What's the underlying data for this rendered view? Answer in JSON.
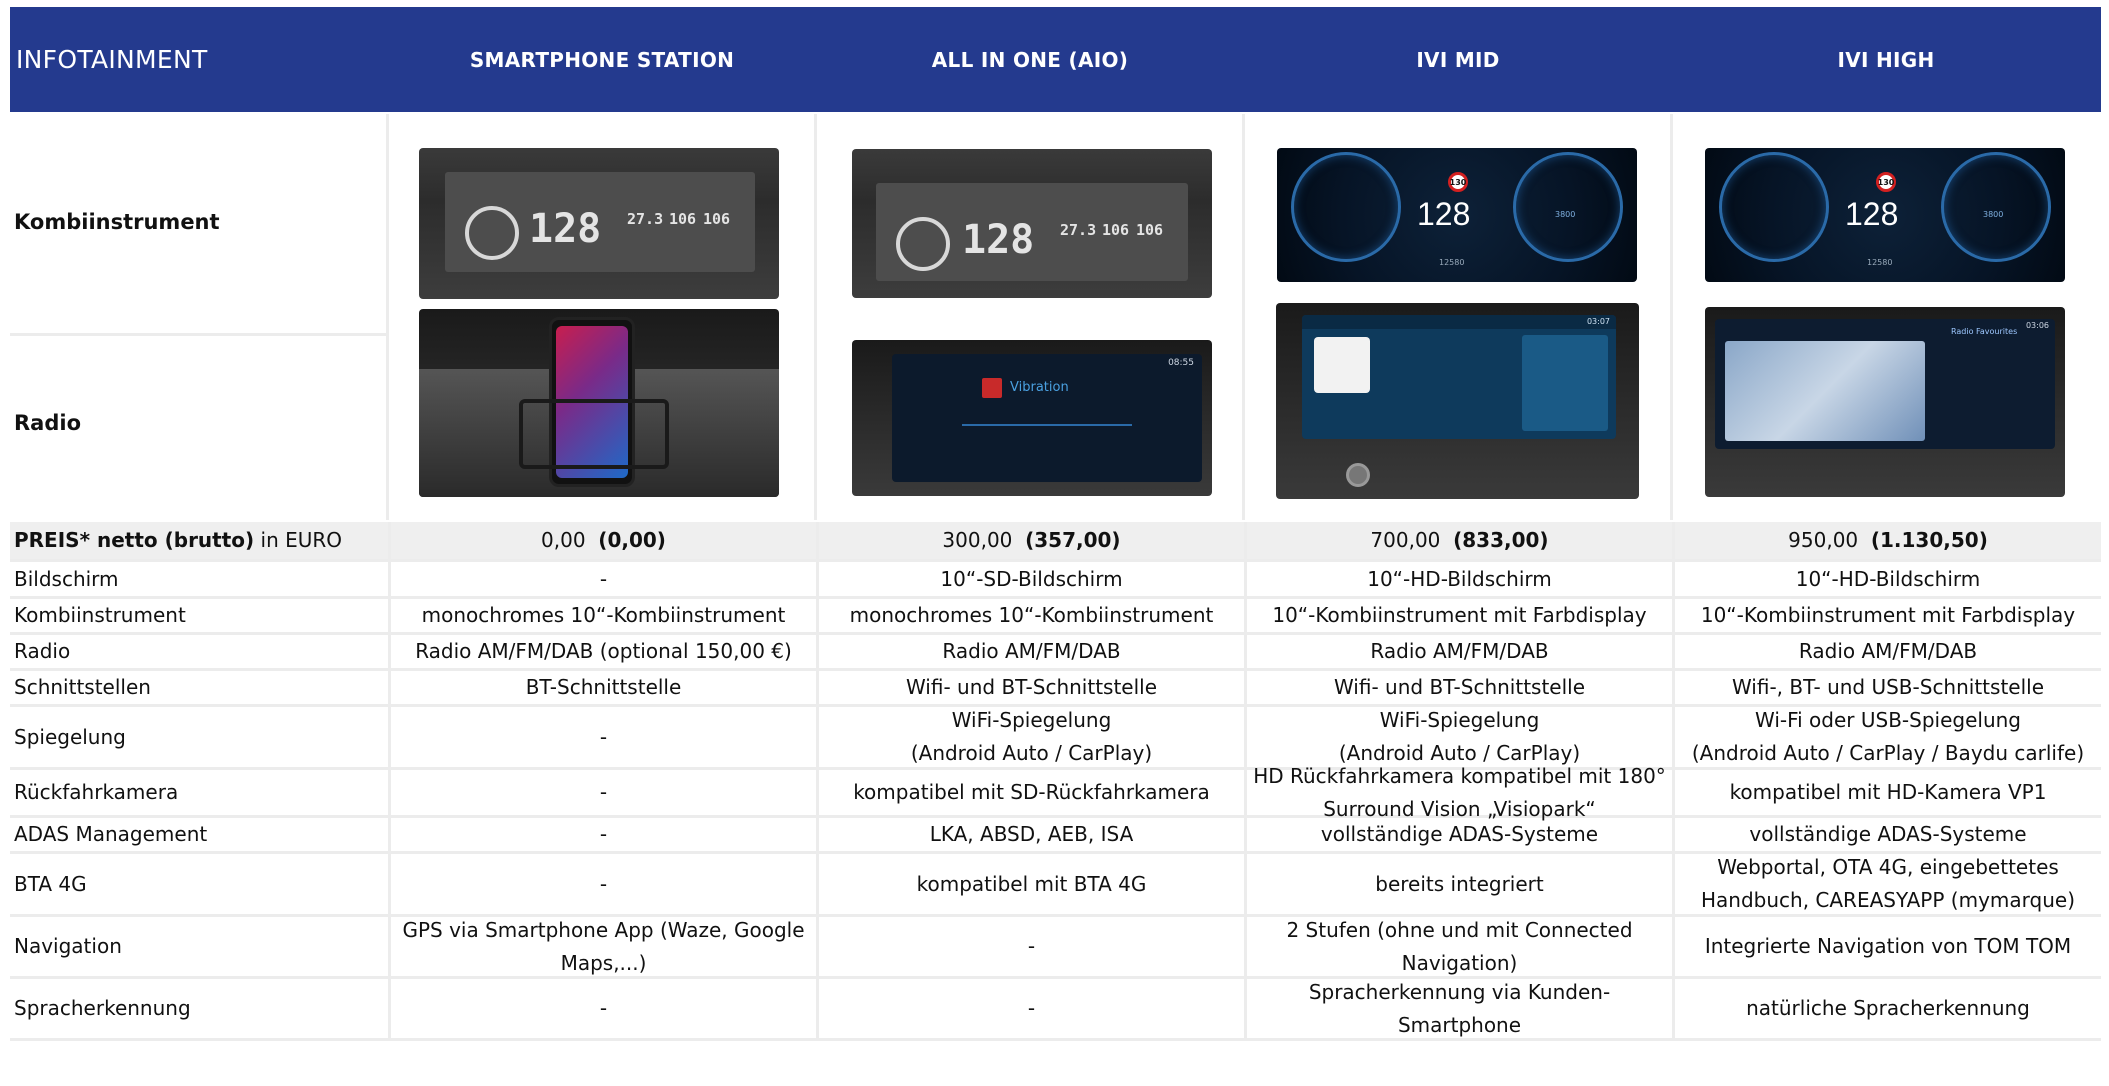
{
  "header": {
    "title": "INFOTAINMENT",
    "columns": [
      "SMARTPHONE STATION",
      "ALL IN ONE (AIO)",
      "IVI MID",
      "IVI HIGH"
    ]
  },
  "image_rows": {
    "kombi_label": "Kombiinstrument",
    "radio_label": "Radio"
  },
  "shots": {
    "mono_speed": "128",
    "mono_small": [
      "27.3",
      "106",
      "106"
    ],
    "color_speed": "128",
    "color_sign": "130",
    "color_rpm": "3800",
    "color_odo": "12580",
    "aio_radio_title": "Vibration",
    "aio_radio_time": "08:55",
    "mid_radio_time": "03:07",
    "high_radio_title": "Radio Favourites",
    "high_radio_time": "03:06"
  },
  "price_row": {
    "label_bold": "PREIS* netto (brutto)",
    "label_rest": " in EURO",
    "values": [
      {
        "net": "0,00",
        "gross": "(0,00)"
      },
      {
        "net": "300,00",
        "gross": "(357,00)"
      },
      {
        "net": "700,00",
        "gross": "(833,00)"
      },
      {
        "net": "950,00",
        "gross": "(1.130,50)"
      }
    ]
  },
  "rows": [
    {
      "label": "Bildschirm",
      "cells": [
        "-",
        "10“-SD-Bildschirm",
        "10“-HD-Bildschirm",
        "10“-HD-Bildschirm"
      ]
    },
    {
      "label": "Kombiinstrument",
      "cells": [
        "monochromes 10“-Kombiinstrument",
        "monochromes 10“-Kombiinstrument",
        "10“-Kombiinstrument mit Farbdisplay",
        "10“-Kombiinstrument mit Farbdisplay"
      ]
    },
    {
      "label": "Radio",
      "cells": [
        "Radio AM/FM/DAB (optional 150,00 €)",
        "Radio AM/FM/DAB",
        "Radio AM/FM/DAB",
        "Radio AM/FM/DAB"
      ]
    },
    {
      "label": "Schnittstellen",
      "cells": [
        "BT-Schnittstelle",
        "Wifi- und BT-Schnittstelle",
        "Wifi- und BT-Schnittstelle",
        "Wifi-, BT- und USB-Schnittstelle"
      ]
    },
    {
      "label": "Spiegelung",
      "cells": [
        "-",
        "WiFi-Spiegelung\n(Android Auto / CarPlay)",
        "WiFi-Spiegelung\n(Android Auto / CarPlay)",
        "Wi-Fi oder USB-Spiegelung\n(Android Auto / CarPlay / Baydu carlife)"
      ]
    },
    {
      "label": "Rückfahrkamera",
      "cells": [
        "-",
        "kompatibel mit SD-Rückfahrkamera",
        "HD Rückfahrkamera kompatibel mit 180°\nSurround Vision „Visiopark“",
        "kompatibel mit HD-Kamera VP1"
      ]
    },
    {
      "label": "ADAS Management",
      "cells": [
        "-",
        "LKA, ABSD, AEB, ISA",
        "vollständige ADAS-Systeme",
        "vollständige ADAS-Systeme"
      ]
    },
    {
      "label": "BTA 4G",
      "cells": [
        "-",
        "kompatibel mit BTA 4G",
        "bereits integriert",
        "Webportal, OTA 4G, eingebettetes\nHandbuch, CAREASYAPP (mymarque)"
      ]
    },
    {
      "label": "Navigation",
      "cells": [
        "GPS via Smartphone App (Waze, Google\nMaps,...)",
        "-",
        "2 Stufen (ohne und mit Connected\nNavigation)",
        "Integrierte Navigation von TOM TOM"
      ]
    },
    {
      "label": "Spracherkennung",
      "cells": [
        "-",
        "-",
        "Spracherkennung via Kunden-\nSmartphone",
        "natürliche Spracherkennung"
      ]
    }
  ]
}
